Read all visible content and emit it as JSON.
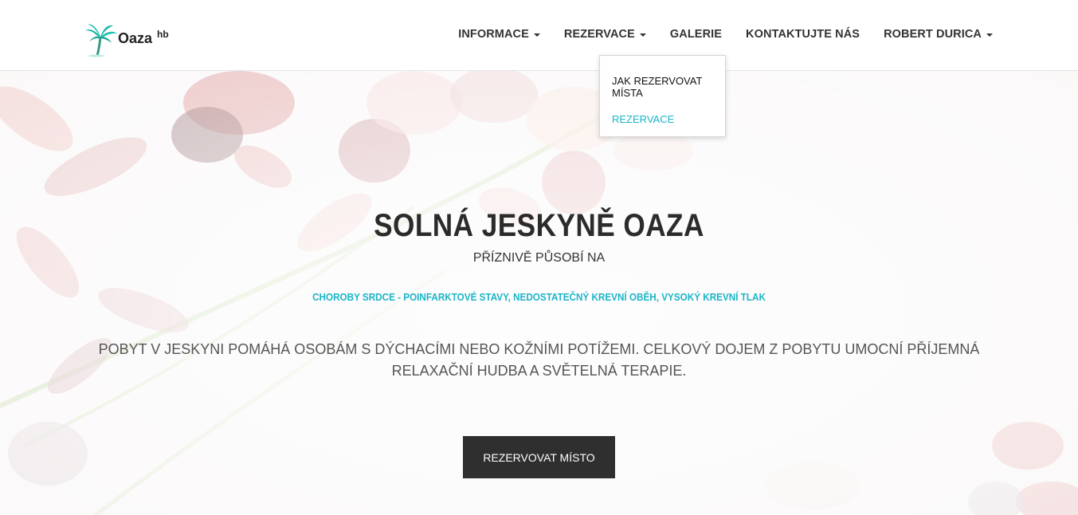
{
  "brand": {
    "name": "Oaza",
    "sup": "hb",
    "accent": "#1ab5c8"
  },
  "nav": {
    "items": [
      {
        "label": "INFORMACE",
        "has_caret": true
      },
      {
        "label": "REZERVACE",
        "has_caret": true
      },
      {
        "label": "GALERIE",
        "has_caret": false
      },
      {
        "label": "KONTAKTUJTE NÁS",
        "has_caret": false
      },
      {
        "label": "ROBERT DURICA",
        "has_caret": true
      }
    ],
    "dropdown": {
      "items": [
        {
          "label": "JAK REZERVOVAT MÍSTA"
        },
        {
          "label": "REZERVACE",
          "active": true
        }
      ]
    }
  },
  "hero": {
    "title": "SOLNÁ JESKYNĚ OAZA",
    "subtitle": "PŘÍZNIVĚ PŮSOBÍ NA",
    "highlight": "CHOROBY SRDCE - POINFARKTOVÉ STAVY, NEDOSTATEČNÝ KREVNÍ OBĚH, VYSOKÝ KREVNÍ TLAK",
    "description": "POBYT V JESKYNI POMÁHÁ OSOBÁM S DÝCHACÍMI NEBO KOŽNÍMI POTÍŽEMI. CELKOVÝ DOJEM Z POBYTU UMOCNÍ PŘÍJEMNÁ RELAXAČNÍ HUDBA A SVĚTELNÁ TERAPIE.",
    "cta_label": "REZERVOVAT MÍSTO"
  },
  "icons": {
    "logo": "palm-tree-icon",
    "caret": "caret-down-icon"
  }
}
